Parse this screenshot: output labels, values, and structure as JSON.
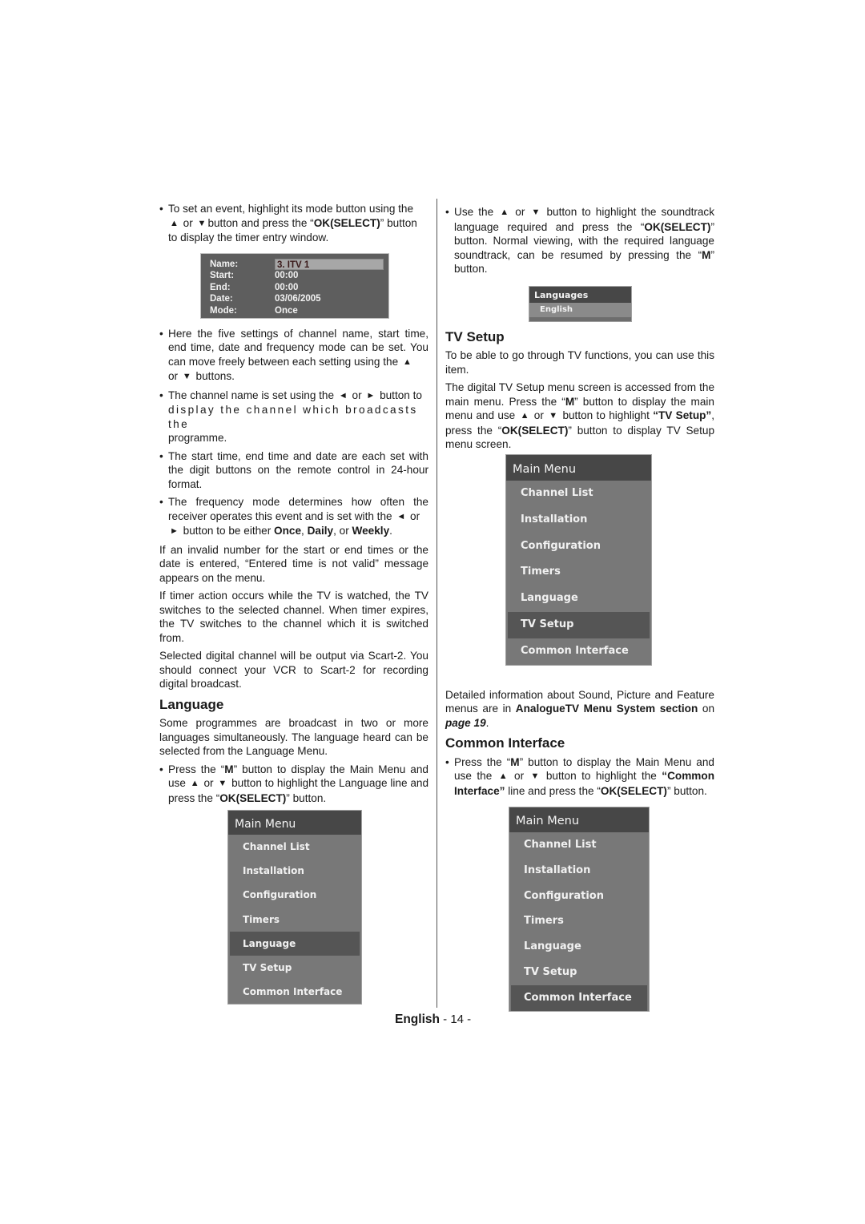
{
  "page": {
    "language": "English",
    "number": "- 14 -"
  },
  "left": {
    "bullet1": {
      "pre": "To set an event, highlight its mode button using the",
      "or": "or",
      "mid": "button and press the “",
      "bold": "OK(SELECT)",
      "post": "” button to display the timer entry window."
    },
    "timer_window": {
      "rows": [
        {
          "label": "Name:",
          "value": "3. ITV 1",
          "selected": true
        },
        {
          "label": "Start:",
          "value": "00:00"
        },
        {
          "label": "End:",
          "value": "00:00"
        },
        {
          "label": "Date:",
          "value": "03/06/2005"
        },
        {
          "label": "Mode:",
          "value": "Once"
        }
      ]
    },
    "bullet2": {
      "text": "Here the five settings of channel name, start time, end time, date and frequency mode can be set. You can move freely between each setting using the",
      "or": "or",
      "post": "buttons."
    },
    "bullet3": {
      "pre": "The channel name is set using the",
      "or": "or",
      "post": "button to",
      "spaced": "display the channel which broadcasts the",
      "last": "programme."
    },
    "bullet4": {
      "text": "The start time, end time and date are each set with the digit buttons on the remote control in 24-hour format."
    },
    "bullet5": {
      "pre": "The frequency mode determines how often the receiver operates this event and is set with the",
      "or": "or",
      "mid": "button to be either",
      "once": "Once",
      "daily": "Daily",
      "or2": ", or",
      "weekly": "Weekly"
    },
    "para1": "If an invalid number for the start or end times or the date is entered, “Entered time is not valid” message appears on the menu.",
    "para2": "If timer action occurs while the TV is watched, the TV switches to the selected channel. When timer expires, the TV switches to the channel which it is switched from.",
    "para3": "Selected digital channel will be output via Scart-2. You should connect your VCR to Scart-2 for recording digital broadcast.",
    "language_heading": "Language",
    "language_para": "Some programmes are broadcast in two or more languages simultaneously. The language heard can be selected from the Language Menu.",
    "language_bullet": {
      "pre": "Press the “",
      "m": "M",
      "mid": "” button to display the Main Menu and use",
      "or": "or",
      "mid2": "button to highlight the Language line and press the “",
      "bold": "OK(SELECT)",
      "post": "” button."
    }
  },
  "right": {
    "bullet1": {
      "pre": "Use the",
      "or": "or",
      "mid": "button to highlight the soundtrack language required and press the “",
      "bold": "OK(SELECT)",
      "mid2": "” button. Normal viewing, with the required language soundtrack, can be resumed by pressing the “",
      "m": "M",
      "post": "” button."
    },
    "languages_box": {
      "title": "Languages",
      "item": "English"
    },
    "tvsetup_heading": "TV Setup",
    "tvsetup_para1": "To be able to go through TV functions, you can use this item.",
    "tvsetup_para2": {
      "pre": "The digital TV Setup menu screen is accessed from the main menu. Press the “",
      "m": "M",
      "mid": "” button to display the main menu and use",
      "or": "or",
      "mid2": "button to highlight",
      "bold1": "“TV Setup”",
      "mid3": ", press the “",
      "bold2": "OK(SELECT)",
      "post": "” button to display TV Setup menu screen."
    },
    "detail_para": {
      "pre": "Detailed information about Sound, Picture and Feature menus are in",
      "bold": "AnalogueTV Menu System section",
      "mid": "on",
      "italic": "page 19",
      "post": "."
    },
    "ci_heading": "Common Interface",
    "ci_bullet": {
      "pre": "Press the “",
      "m": "M",
      "mid": "” button to display the Main Menu and use the",
      "or": "or",
      "mid2": "button to highlight the",
      "bold1": "“Common Interface”",
      "mid3": "line and press the “",
      "bold2": "OK(SELECT)",
      "post": "” button."
    }
  },
  "main_menu": {
    "title": "Main Menu",
    "items": [
      "Channel List",
      "Installation",
      "Configuration",
      "Timers",
      "Language",
      "TV Setup",
      "Common Interface"
    ]
  },
  "menus": {
    "language_menu_active": "Language",
    "tvsetup_menu_active": "TV Setup",
    "ci_menu_active": "Common Interface"
  },
  "icons": {
    "up": "▲",
    "down": "▼",
    "left": "◄",
    "right": "►",
    "bullet": "•"
  }
}
